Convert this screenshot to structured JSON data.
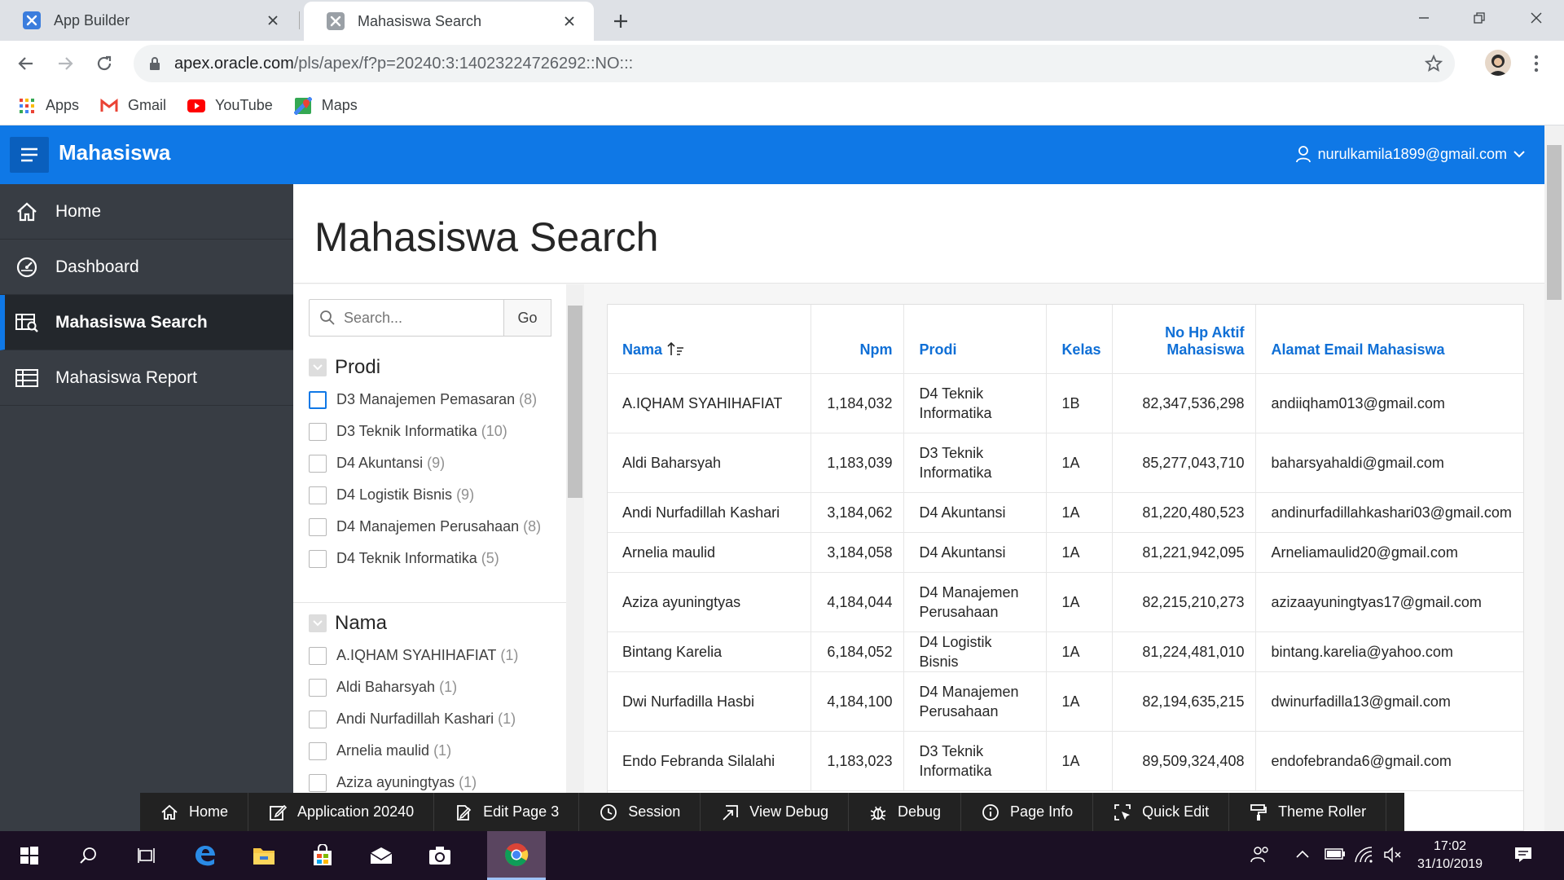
{
  "browser": {
    "tabs": [
      {
        "title": "App Builder",
        "icon": "apex-icon",
        "active": false
      },
      {
        "title": "Mahasiswa Search",
        "icon": "apex-icon",
        "active": true
      }
    ],
    "url_host": "apex.oracle.com",
    "url_path": "/pls/apex/f?p=20240:3:14023224726292::NO:::",
    "bookmarks": [
      {
        "label": "Apps",
        "icon": "apps-grid-icon"
      },
      {
        "label": "Gmail",
        "icon": "gmail-icon"
      },
      {
        "label": "YouTube",
        "icon": "youtube-icon"
      },
      {
        "label": "Maps",
        "icon": "maps-icon"
      }
    ]
  },
  "app": {
    "title": "Mahasiswa",
    "user": "nurulkamila1899@gmail.com",
    "accent": "#0f78e6"
  },
  "nav": {
    "items": [
      {
        "label": "Home",
        "icon": "home-icon",
        "active": false
      },
      {
        "label": "Dashboard",
        "icon": "dashboard-icon",
        "active": false
      },
      {
        "label": "Mahasiswa Search",
        "icon": "search-report-icon",
        "active": true
      },
      {
        "label": "Mahasiswa Report",
        "icon": "table-icon",
        "active": false
      }
    ]
  },
  "page": {
    "title": "Mahasiswa Search",
    "search_placeholder": "Search...",
    "go_label": "Go"
  },
  "facets": {
    "prodi": {
      "title": "Prodi",
      "options": [
        {
          "label": "D3 Manajemen Pemasaran",
          "count": "(8)"
        },
        {
          "label": "D3 Teknik Informatika",
          "count": "(10)"
        },
        {
          "label": "D4 Akuntansi",
          "count": "(9)"
        },
        {
          "label": "D4 Logistik Bisnis",
          "count": "(9)"
        },
        {
          "label": "D4 Manajemen Perusahaan",
          "count": "(8)"
        },
        {
          "label": "D4 Teknik Informatika",
          "count": "(5)"
        }
      ]
    },
    "nama": {
      "title": "Nama",
      "options": [
        {
          "label": "A.IQHAM SYAHIHAFIAT",
          "count": "(1)"
        },
        {
          "label": "Aldi Baharsyah",
          "count": "(1)"
        },
        {
          "label": "Andi Nurfadillah Kashari",
          "count": "(1)"
        },
        {
          "label": "Arnelia maulid",
          "count": "(1)"
        },
        {
          "label": "Aziza ayuningtyas",
          "count": "(1)"
        }
      ]
    }
  },
  "report": {
    "columns": [
      "Nama",
      "Npm",
      "Prodi",
      "Kelas",
      "No Hp Aktif Mahasiswa",
      "Alamat Email Mahasiswa"
    ],
    "rows": [
      [
        "A.IQHAM SYAHIHAFIAT",
        "1,184,032",
        "D4 Teknik Informatika",
        "1B",
        "82,347,536,298",
        "andiiqham013@gmail.com"
      ],
      [
        "Aldi Baharsyah",
        "1,183,039",
        "D3 Teknik Informatika",
        "1A",
        "85,277,043,710",
        "baharsyahaldi@gmail.com"
      ],
      [
        "Andi Nurfadillah Kashari",
        "3,184,062",
        "D4 Akuntansi",
        "1A",
        "81,220,480,523",
        "andinurfadillahkashari03@gmail.com"
      ],
      [
        "Arnelia maulid",
        "3,184,058",
        "D4 Akuntansi",
        "1A",
        "81,221,942,095",
        "Arneliamaulid20@gmail.com"
      ],
      [
        "Aziza ayuningtyas",
        "4,184,044",
        "D4 Manajemen Perusahaan",
        "1A",
        "82,215,210,273",
        "azizaayuningtyas17@gmail.com"
      ],
      [
        "Bintang Karelia",
        "6,184,052",
        "D4 Logistik Bisnis",
        "1A",
        "81,224,481,010",
        "bintang.karelia@yahoo.com"
      ],
      [
        "Dwi Nurfadilla Hasbi",
        "4,184,100",
        "D4 Manajemen Perusahaan",
        "1A",
        "82,194,635,215",
        "dwinurfadilla13@gmail.com"
      ],
      [
        "Endo Febranda Silalahi",
        "1,183,023",
        "D3 Teknik Informatika",
        "1A",
        "89,509,324,408",
        "endofebranda6@gmail.com"
      ]
    ]
  },
  "devbar": {
    "items": [
      {
        "label": "Home",
        "icon": "home-icon"
      },
      {
        "label": "Application 20240",
        "icon": "edit-icon"
      },
      {
        "label": "Edit Page 3",
        "icon": "edit-page-icon"
      },
      {
        "label": "Session",
        "icon": "clock-icon"
      },
      {
        "label": "View Debug",
        "icon": "view-debug-icon"
      },
      {
        "label": "Debug",
        "icon": "bug-icon"
      },
      {
        "label": "Page Info",
        "icon": "info-icon"
      },
      {
        "label": "Quick Edit",
        "icon": "quick-edit-icon"
      },
      {
        "label": "Theme Roller",
        "icon": "paint-roller-icon"
      },
      {
        "label": "",
        "icon": "gear-icon"
      }
    ]
  },
  "taskbar": {
    "time": "17:02",
    "date": "31/10/2019"
  }
}
